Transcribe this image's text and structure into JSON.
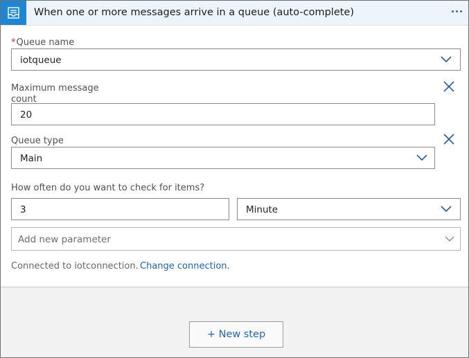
{
  "header": {
    "title": "When one or more messages arrive in a queue (auto-complete)",
    "icon": "queue-icon",
    "more_icon": "ellipsis-icon",
    "accent": "#1f86d3"
  },
  "queue_name": {
    "required_mark": "*",
    "label": "Queue name",
    "value": "iotqueue"
  },
  "max_count": {
    "label_line1": "Maximum message",
    "label_line2": "count",
    "value": "20"
  },
  "queue_type": {
    "label": "Queue type",
    "value": "Main"
  },
  "frequency": {
    "label": "How often do you want to check for items?",
    "interval": "3",
    "unit": "Minute"
  },
  "add_parameter": {
    "placeholder": "Add new parameter"
  },
  "connection": {
    "text": "Connected to iotconnection.",
    "link": "Change connection."
  },
  "new_step": {
    "label": "+ New step"
  }
}
